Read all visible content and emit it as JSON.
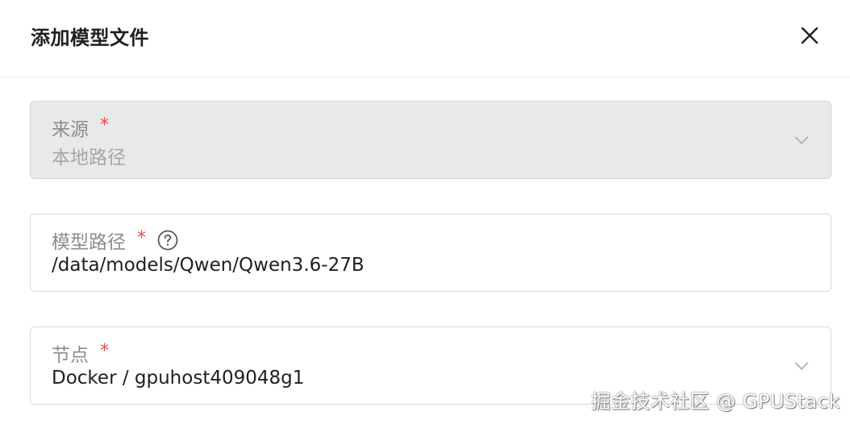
{
  "dialog": {
    "title": "添加模型文件",
    "close_icon": "close-icon"
  },
  "form": {
    "source": {
      "label": "来源",
      "required_mark": "*",
      "value": "本地路径",
      "disabled": true,
      "icon": "chevron-down-icon"
    },
    "model_path": {
      "label": "模型路径",
      "required_mark": "*",
      "help_icon": "question-circle-icon",
      "value": "/data/models/Qwen/Qwen3.6-27B"
    },
    "node": {
      "label": "节点",
      "required_mark": "*",
      "value": "Docker / gpuhost409048g1",
      "icon": "chevron-down-icon"
    }
  },
  "watermark": "掘金技术社区 @ GPUStack",
  "colors": {
    "required": "#e5484d",
    "disabled_bg": "#e9e9e9",
    "border": "#d9d9d9",
    "label": "#8c8c8c"
  }
}
